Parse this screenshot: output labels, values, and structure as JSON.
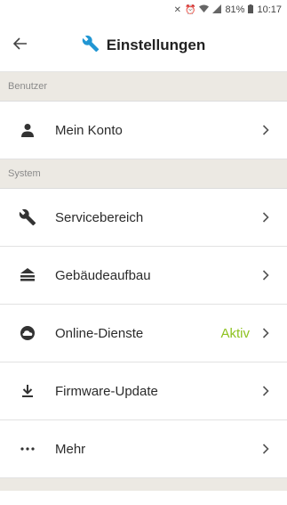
{
  "status_bar": {
    "battery": "81%",
    "time": "10:17"
  },
  "header": {
    "title": "Einstellungen",
    "back_icon": "arrow-left-icon",
    "title_icon": "wrench-icon",
    "accent": "#2196d3"
  },
  "sections": [
    {
      "label": "Benutzer"
    },
    {
      "label": "System"
    }
  ],
  "items": [
    {
      "label": "Mein Konto",
      "icon": "person-icon"
    },
    {
      "label": "Servicebereich",
      "icon": "wrench-icon"
    },
    {
      "label": "Gebäudeaufbau",
      "icon": "building-icon"
    },
    {
      "label": "Online-Dienste",
      "icon": "cloud-icon",
      "status": "Aktiv",
      "status_color": "#8dc21f"
    },
    {
      "label": "Firmware-Update",
      "icon": "download-icon"
    },
    {
      "label": "Mehr",
      "icon": "more-icon"
    }
  ]
}
